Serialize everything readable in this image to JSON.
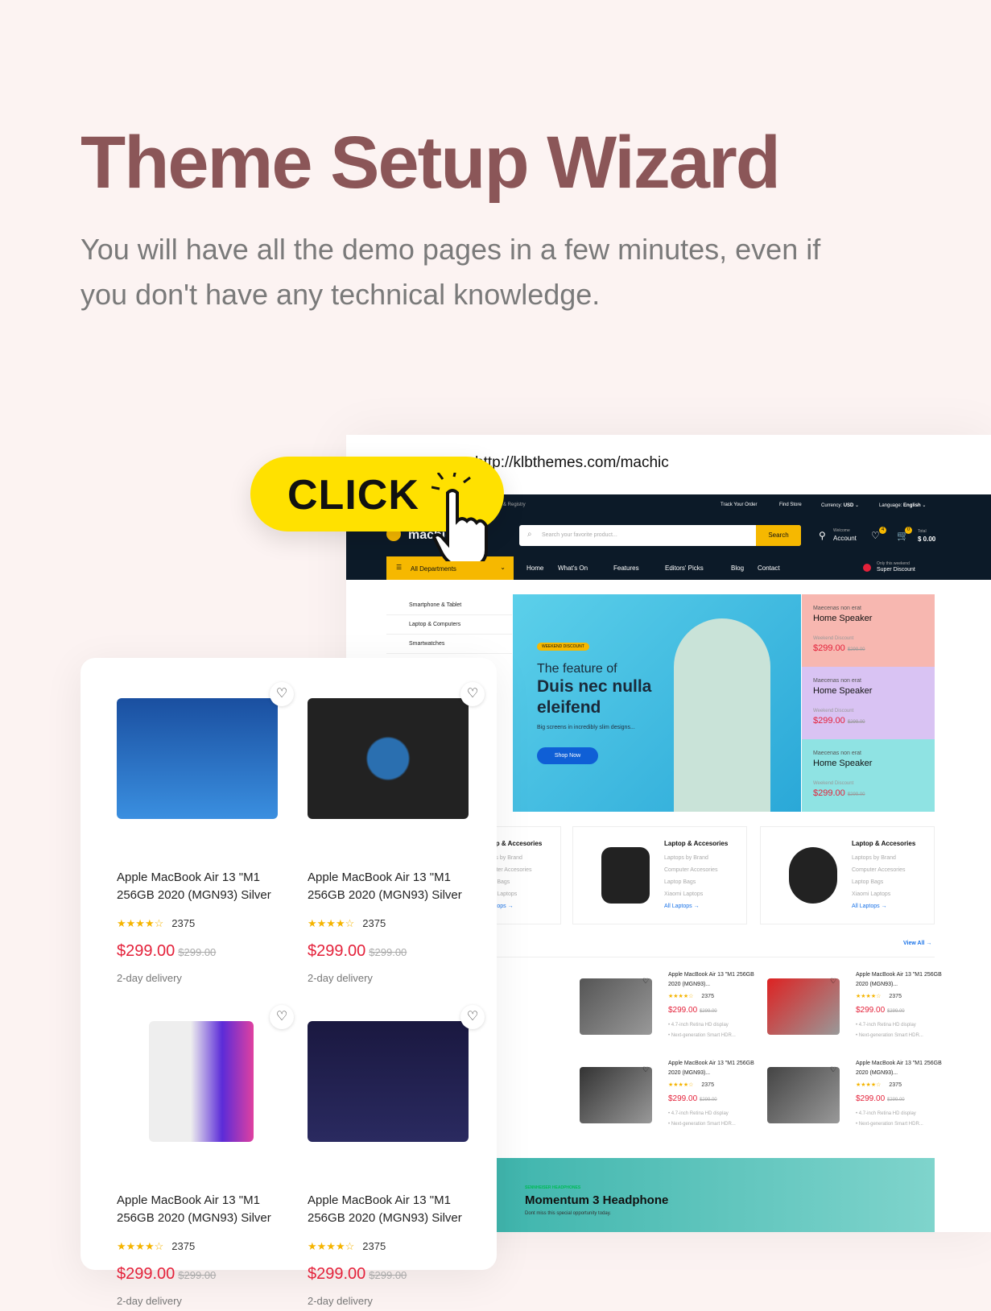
{
  "headline": "Theme Setup Wizard",
  "subheadline": "You will have all the demo pages in a few minutes, even if you don't have any technical knowledge.",
  "cta": {
    "label": "CLICK",
    "icon": "hand-pointer-icon",
    "color": "#ffe100"
  },
  "browser": {
    "url": "http://klbthemes.com/machic"
  },
  "site": {
    "topbar": {
      "left": "& Registry",
      "track": "Track Your Order",
      "store": "Find Store",
      "currency_label": "Currency:",
      "currency": "USD",
      "language_label": "Language:",
      "language": "English"
    },
    "logo": "machic",
    "search": {
      "placeholder": "Search your favorite product...",
      "button": "Search"
    },
    "account": {
      "welcome": "Welcome",
      "label": "Account"
    },
    "wishlist_count": "4",
    "cart_count": "0",
    "total_label": "Total",
    "total": "$ 0.00",
    "nav": {
      "departments": "All Departments",
      "items": [
        "Home",
        "What's On",
        "Features",
        "Editors' Picks",
        "Blog",
        "Contact"
      ],
      "promo_small": "Only this weekend",
      "promo": "Super Discount"
    },
    "sidebar": [
      "Smartphone & Tablet",
      "Laptop & Computers",
      "Smartwatches"
    ],
    "hero": {
      "badge": "WEEKEND DISCOUNT",
      "line1": "The feature of",
      "line2": "Duis nec nulla",
      "line3": "eleifend",
      "desc": "Big screens in incredibly slim designs...",
      "button": "Shop Now"
    },
    "promos": [
      {
        "small": "Maecenas non erat",
        "title": "Home Speaker",
        "tag": "Weekend Discount",
        "price": "$299.00",
        "old": "$299.00",
        "bg": "#f7b7b0"
      },
      {
        "small": "Maecenas non erat",
        "title": "Home Speaker",
        "tag": "Weekend Discount",
        "price": "$299.00",
        "old": "$299.00",
        "bg": "#d9c3f3"
      },
      {
        "small": "Maecenas non erat",
        "title": "Home Speaker",
        "tag": "Weekend Discount",
        "price": "$299.00",
        "old": "$299.00",
        "bg": "#8fe3e3"
      }
    ],
    "categories": [
      {
        "title": "Laptop & Accesories",
        "links": [
          "Laptops by Brand",
          "Computer Accesories",
          "Laptop Bags",
          "Xiaomi Laptops"
        ],
        "all": "All Laptops"
      },
      {
        "title": "Laptop & Accesories",
        "links": [
          "Laptops by Brand",
          "Computer Accesories",
          "Laptop Bags",
          "Xiaomi Laptops"
        ],
        "all": "All Laptops"
      },
      {
        "title": "Laptop & Accesories",
        "links": [
          "Laptops by Brand",
          "Computer Accesories",
          "Laptop Bags",
          "Xiaomi Laptops"
        ],
        "all": "All Laptops"
      }
    ],
    "view_all": "View All",
    "mini_product": {
      "name": "Apple MacBook Air 13 \"M1 256GB 2020 (MGN93)...",
      "stars": "★★★★☆",
      "reviews": "2375",
      "price": "$299.00",
      "old": "$299.00",
      "f1": "• 4.7-inch Retina HD display",
      "f2": "• Next-generation Smart HDR..."
    },
    "banner": {
      "tag": "SENNHEISER HEADPHONES",
      "title": "Momentum 3 Headphone",
      "desc": "Dont miss this special opportunity today."
    }
  },
  "card_product": {
    "name": "Apple MacBook Air 13 \"M1 256GB 2020 (MGN93) Silver",
    "stars": "★★★★☆",
    "reviews": "2375",
    "price": "$299.00",
    "old": "$299.00",
    "delivery": "2-day delivery"
  },
  "colors": {
    "headline": "#8b5658",
    "header_bg": "#0c1a28",
    "accent": "#f6b800",
    "price": "#e4213a",
    "link": "#1a73e8"
  }
}
